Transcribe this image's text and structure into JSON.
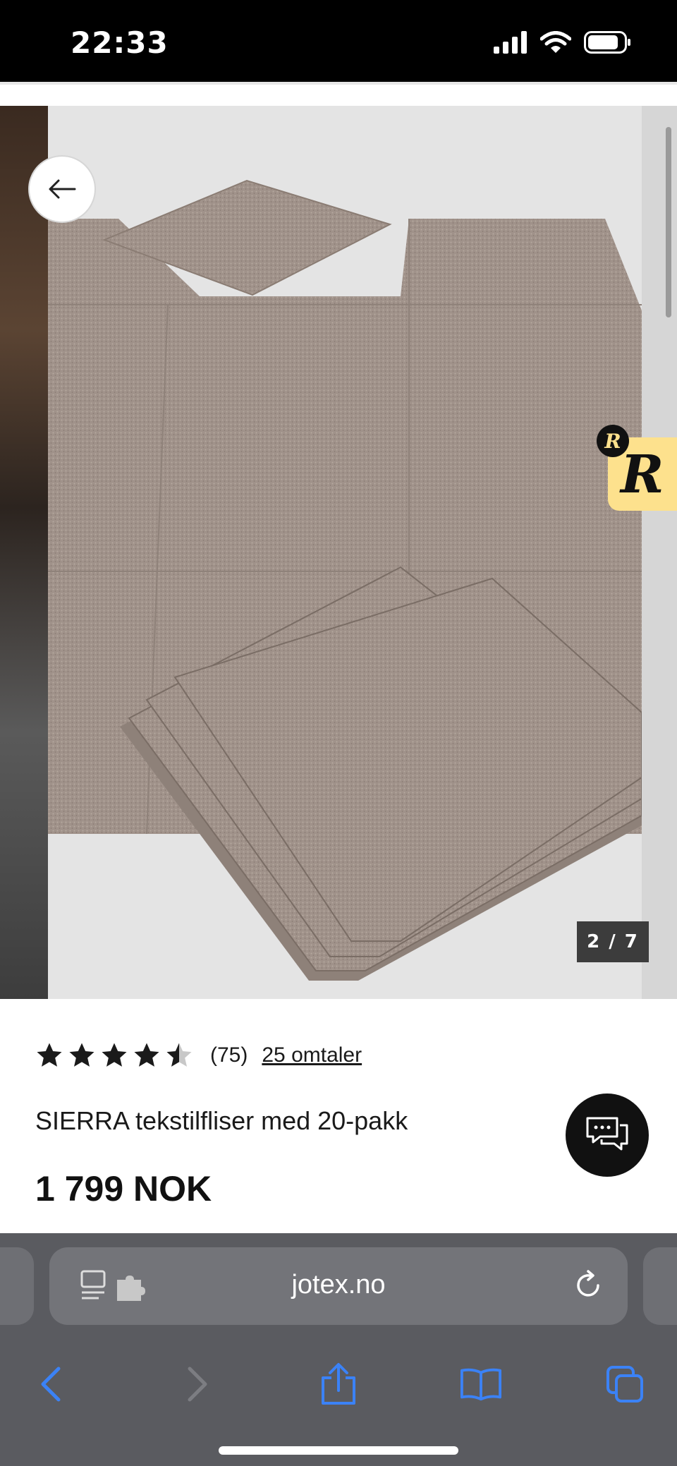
{
  "status_bar": {
    "time": "22:33",
    "icons": [
      "signal-icon",
      "wifi-icon",
      "battery-icon"
    ]
  },
  "gallery": {
    "counter": "2 / 7",
    "back_icon": "arrow-left-icon",
    "badge_small_letter": "R",
    "badge_letter": "R"
  },
  "product": {
    "rating": 4.5,
    "rating_count": "(75)",
    "reviews_link": "25 omtaler",
    "title": "SIERRA tekstilfliser med 20-pakk",
    "price": "1 799 NOK"
  },
  "browser": {
    "url": "jotex.no",
    "accent_color": "#3b82f6"
  }
}
